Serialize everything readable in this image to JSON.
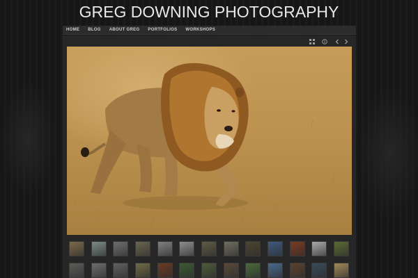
{
  "header": {
    "title": "GREG DOWNING PHOTOGRAPHY"
  },
  "nav": {
    "items": [
      {
        "label": "HOME"
      },
      {
        "label": "BLOG"
      },
      {
        "label": "ABOUT GREG"
      },
      {
        "label": "PORTFOLIOS"
      },
      {
        "label": "WORKSHOPS"
      }
    ]
  },
  "toolbar": {
    "icons": [
      "grid-icon",
      "info-icon",
      "chevron-left-icon",
      "chevron-right-icon"
    ]
  },
  "photo": {
    "subject": "lion"
  },
  "thumbnails": {
    "row1": [
      "#7b6a4a",
      "#7a8a86",
      "#6e6e6e",
      "#6a6550",
      "#808080",
      "#8d8d8d",
      "#5e5a44",
      "#706e60",
      "#4d4531",
      "#3d5a7c",
      "#7a3a22",
      "#a9a9a9",
      "#5a6a32"
    ],
    "row2": [
      "#5c5c58",
      "#6d6d6d",
      "#606060",
      "#6e6a46",
      "#6a3a22",
      "#3c5a34",
      "#4c5a3a",
      "#5a4a3a",
      "#4a6a3a",
      "#4a6a8c",
      "#5a4230",
      "#3a4a5a",
      "#a08a5a"
    ]
  },
  "colors": {
    "background": "#151515",
    "nav": "#2c2c2c",
    "frame": "#262626",
    "title": "#e8e8e8"
  }
}
